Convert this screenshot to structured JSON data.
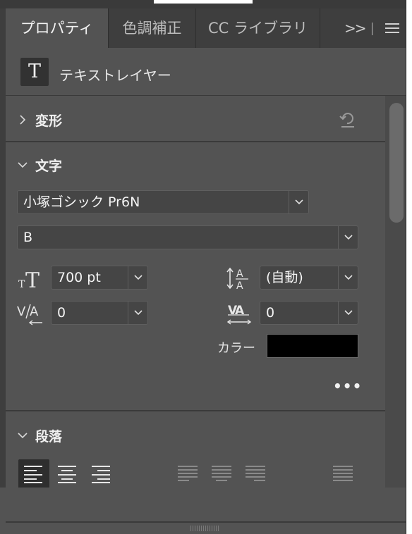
{
  "tabs": [
    {
      "label": "プロパティ",
      "active": true
    },
    {
      "label": "色調補正",
      "active": false
    },
    {
      "label": "CC ライブラリ",
      "active": false
    }
  ],
  "tabs_more": ">>",
  "layer": {
    "icon_letter": "T",
    "label": "テキストレイヤー"
  },
  "transform": {
    "title": "変形"
  },
  "character": {
    "title": "文字",
    "font_family": "小塚ゴシック Pr6N",
    "font_style": "B",
    "font_size": "700 pt",
    "leading": "(自動)",
    "kerning": "0",
    "tracking": "0",
    "color_label": "カラー",
    "color": "#000000",
    "more": "•••"
  },
  "paragraph": {
    "title": "段落"
  },
  "colors": {
    "panel": "#535353",
    "tab_bar": "#3e3e3e",
    "field": "#454545"
  }
}
